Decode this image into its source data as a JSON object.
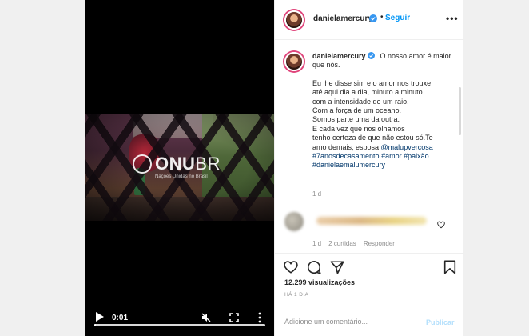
{
  "video": {
    "time": "0:01",
    "progress_fraction": 0.01,
    "logo_text_bold": "ONU",
    "logo_text_light": "BR",
    "logo_subtitle": "Nações Unidas no Brasil"
  },
  "header": {
    "username": "danielamercury",
    "separator": "•",
    "follow_label": "Seguir",
    "more_label": "•••"
  },
  "caption": {
    "username": "danielamercury",
    "intro": ". O nosso amor é maior que nós.",
    "lines": [
      "Eu lhe disse sim e o amor nos trouxe",
      "até aqui dia a dia, minuto a minuto",
      "com a intensidade de um raio.",
      "Com a força de um oceano.",
      "Somos parte uma da outra.",
      "E cada vez que nos olhamos",
      "tenho certeza de que não estou só.Te"
    ],
    "line_love_prefix": "amo demais, esposa ",
    "mention": "@malupvercosa",
    "line_love_suffix": " .",
    "hashtags_line1": "#7anosdecasamento #amor #paixão",
    "hashtags_line2": "#danielaemalumercury",
    "time": "1 d"
  },
  "comment": {
    "time": "1 d",
    "likes": "2 curtidas",
    "reply_label": "Responder"
  },
  "actions": {
    "views": "12.299 visualizações",
    "date": "HÁ 1 DIA",
    "comment_placeholder": "Adicione um comentário...",
    "publish_label": "Publicar"
  },
  "colors": {
    "accent": "#0095f6",
    "link": "#00376b",
    "muted": "#8e8e8e",
    "publish_disabled": "#b2dffc"
  },
  "icons": [
    "play-icon",
    "mute-icon",
    "fullscreen-icon",
    "more-icon",
    "verified-icon",
    "heart-icon",
    "comment-icon",
    "share-icon",
    "bookmark-icon"
  ]
}
